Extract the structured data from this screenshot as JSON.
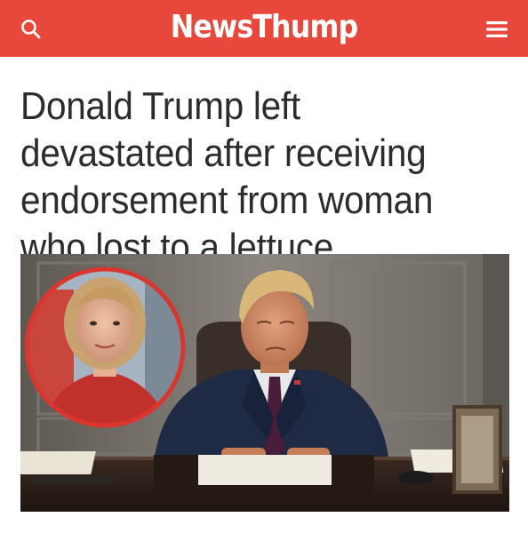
{
  "header": {
    "site_name": "NewsThump",
    "search_icon": "search-icon",
    "menu_icon": "hamburger-menu-icon",
    "brand_color": "#e8473b"
  },
  "article": {
    "headline": "Donald Trump left devastated after receiving endorsement from woman who lost to a lettuce"
  },
  "hero_image": {
    "description_icon": "article-hero-photo"
  }
}
